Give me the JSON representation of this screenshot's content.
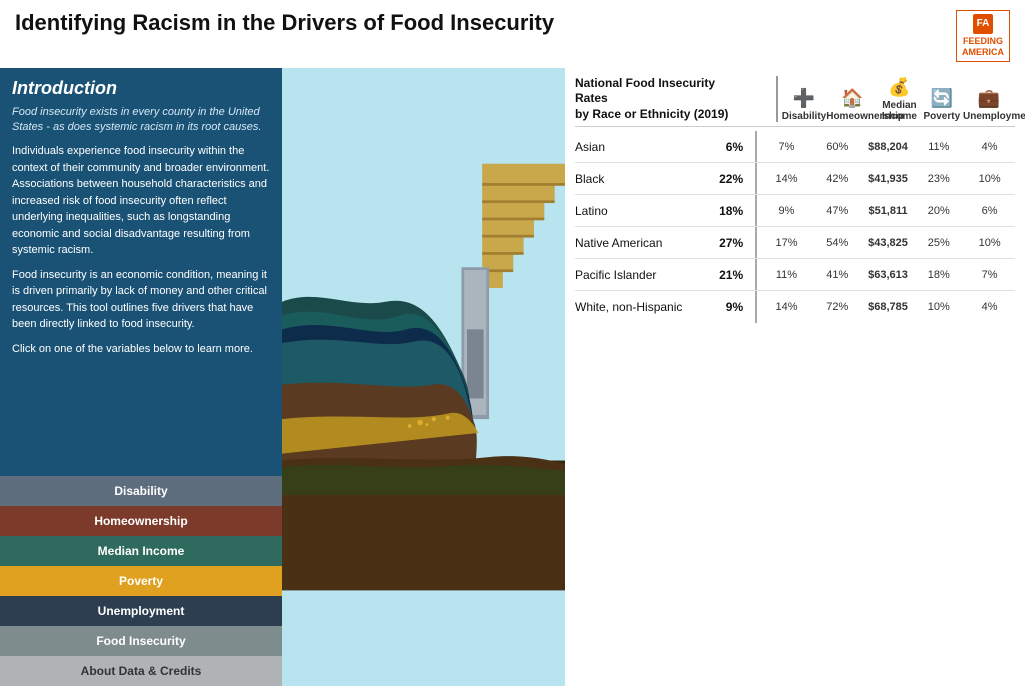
{
  "header": {
    "title": "Identifying Racism in the Drivers of Food Insecurity",
    "logo_line1": "FEEDING",
    "logo_line2": "AMERICA"
  },
  "intro": {
    "title": "Introduction",
    "subtitle": "Food insecurity exists in every county in the United States - as does systemic racism in its root causes.",
    "paragraph1": "Individuals experience food insecurity within the context of their community and broader environment. Associations between household characteristics and increased risk of food insecurity often reflect underlying inequalities, such as longstanding economic and social disadvantage resulting from systemic racism.",
    "paragraph2": "Food insecurity is an economic condition, meaning it is driven primarily by lack of money and other critical resources. This tool outlines five drivers that have been directly linked to food insecurity.",
    "paragraph3": "Click on one of the variables below to learn more."
  },
  "nav_buttons": [
    {
      "id": "disability",
      "label": "Disability",
      "class": "disability"
    },
    {
      "id": "homeownership",
      "label": "Homeownership",
      "class": "homeownership"
    },
    {
      "id": "median-income",
      "label": "Median Income",
      "class": "median-income"
    },
    {
      "id": "poverty",
      "label": "Poverty",
      "class": "poverty"
    },
    {
      "id": "unemployment",
      "label": "Unemployment",
      "class": "unemployment"
    },
    {
      "id": "food-insecurity",
      "label": "Food Insecurity",
      "class": "food-insecurity"
    },
    {
      "id": "about-data",
      "label": "About Data & Credits",
      "class": "about-data"
    }
  ],
  "table": {
    "title": "National Food Insecurity Rates by Race or Ethnicity (2019)",
    "columns": [
      {
        "id": "disability",
        "label": "Disability",
        "icon": "➕"
      },
      {
        "id": "homeownership",
        "label": "Homeownership",
        "icon": "🏠"
      },
      {
        "id": "median_income",
        "label": "Median Income",
        "icon": "💰"
      },
      {
        "id": "poverty",
        "label": "Poverty",
        "icon": "🔄"
      },
      {
        "id": "unemployment",
        "label": "Unemployment",
        "icon": "💼"
      }
    ],
    "rows": [
      {
        "race": "Asian",
        "rate": "6%",
        "disability": "7%",
        "homeownership": "60%",
        "median_income": "$88,204",
        "poverty": "11%",
        "unemployment": "4%"
      },
      {
        "race": "Black",
        "rate": "22%",
        "disability": "14%",
        "homeownership": "42%",
        "median_income": "$41,935",
        "poverty": "23%",
        "unemployment": "10%"
      },
      {
        "race": "Latino",
        "rate": "18%",
        "disability": "9%",
        "homeownership": "47%",
        "median_income": "$51,811",
        "poverty": "20%",
        "unemployment": "6%"
      },
      {
        "race": "Native American",
        "rate": "27%",
        "disability": "17%",
        "homeownership": "54%",
        "median_income": "$43,825",
        "poverty": "25%",
        "unemployment": "10%"
      },
      {
        "race": "Pacific Islander",
        "rate": "21%",
        "disability": "11%",
        "homeownership": "41%",
        "median_income": "$63,613",
        "poverty": "18%",
        "unemployment": "7%"
      },
      {
        "race": "White, non-Hispanic",
        "rate": "9%",
        "disability": "14%",
        "homeownership": "72%",
        "median_income": "$68,785",
        "poverty": "10%",
        "unemployment": "4%"
      }
    ]
  }
}
